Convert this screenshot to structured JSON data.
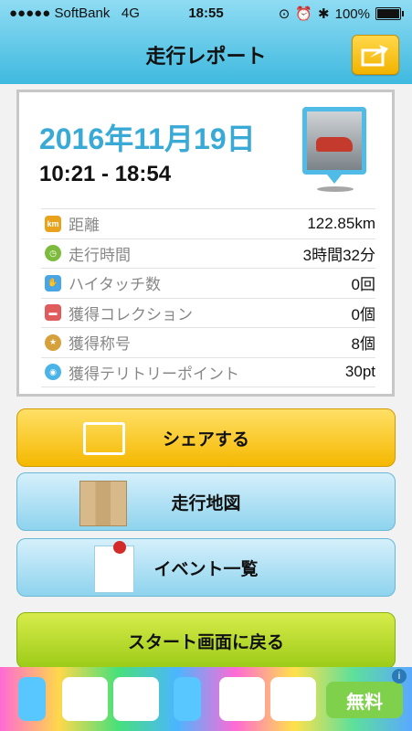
{
  "status_bar": {
    "carrier": "●●●●● SoftBank",
    "network": "4G",
    "time": "18:55",
    "battery": "100%"
  },
  "header": {
    "title": "走行レポート",
    "share_icon": "share-arrow-icon"
  },
  "report": {
    "date": "2016年11月19日",
    "time_range": "10:21 - 18:54",
    "rows": [
      {
        "icon": "km-icon",
        "label": "距離",
        "value": "122.85km"
      },
      {
        "icon": "clock-icon",
        "label": "走行時間",
        "value": "3時間32分"
      },
      {
        "icon": "hand-icon",
        "label": "ハイタッチ数",
        "value": "0回"
      },
      {
        "icon": "car-collection-icon",
        "label": "獲得コレクション",
        "value": "0個"
      },
      {
        "icon": "title-medal-icon",
        "label": "獲得称号",
        "value": "8個"
      },
      {
        "icon": "territory-icon",
        "label": "獲得テリトリーポイント",
        "value": "30pt"
      }
    ]
  },
  "buttons": {
    "share": "シェアする",
    "map": "走行地図",
    "events": "イベント一覧",
    "back_to_start": "スタート画面に戻る"
  },
  "ad": {
    "free_label": "無料",
    "info": "i"
  },
  "colors": {
    "header_blue": "#3fb9df",
    "date_blue": "#39a9d6",
    "share_yellow": "#f5b800",
    "start_green": "#9ccb18"
  }
}
